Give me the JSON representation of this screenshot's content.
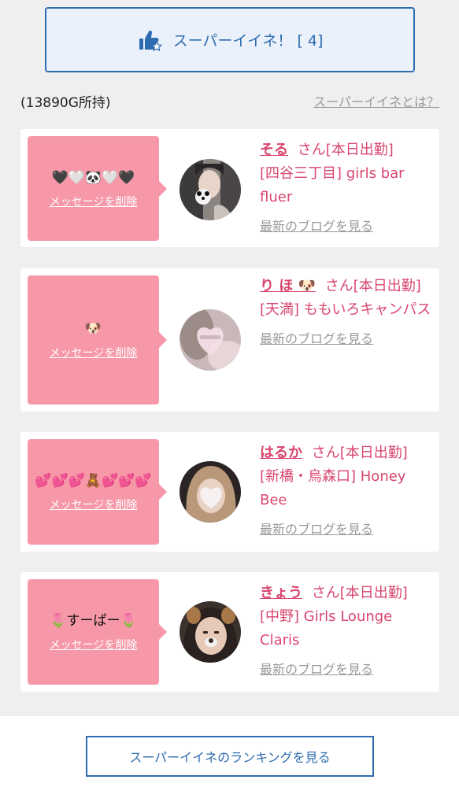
{
  "super_button": {
    "label": "スーパーイイネ！ [ 4]"
  },
  "owned": "(13890G所持)",
  "what_link": "スーパーイイネとは？",
  "cards": [
    {
      "message": "🖤🤍🐼🤍🖤",
      "delete_label": "メッセージを削除",
      "name": "そる",
      "suffix": "さん[本日出勤]",
      "shop": "[四谷三丁目] girls bar fluer",
      "blog_link": "最新のブログを見る"
    },
    {
      "message": "🐶",
      "delete_label": "メッセージを削除",
      "name": "り ほ 🐶",
      "suffix": "さん[本日出勤]",
      "shop": "[天満] ももいろキャンパス",
      "blog_link": "最新のブログを見る"
    },
    {
      "message": "💕💕💕🧸💕💕💕",
      "delete_label": "メッセージを削除",
      "name": "はるか",
      "suffix": "さん[本日出勤]",
      "shop": "[新橋・烏森口] Honey Bee",
      "blog_link": "最新のブログを見る"
    },
    {
      "message": "🌷すーぱー🌷",
      "delete_label": "メッセージを削除",
      "name": "きょう",
      "suffix": "さん[本日出勤]",
      "shop": "[中野] Girls Lounge Claris",
      "blog_link": "最新のブログを見る"
    }
  ],
  "ranking_button": "スーパーイイネのランキングを見る",
  "colors": {
    "accent_blue": "#2e6cb0",
    "pink": "#f798a8",
    "name_pink": "#d9466f"
  }
}
